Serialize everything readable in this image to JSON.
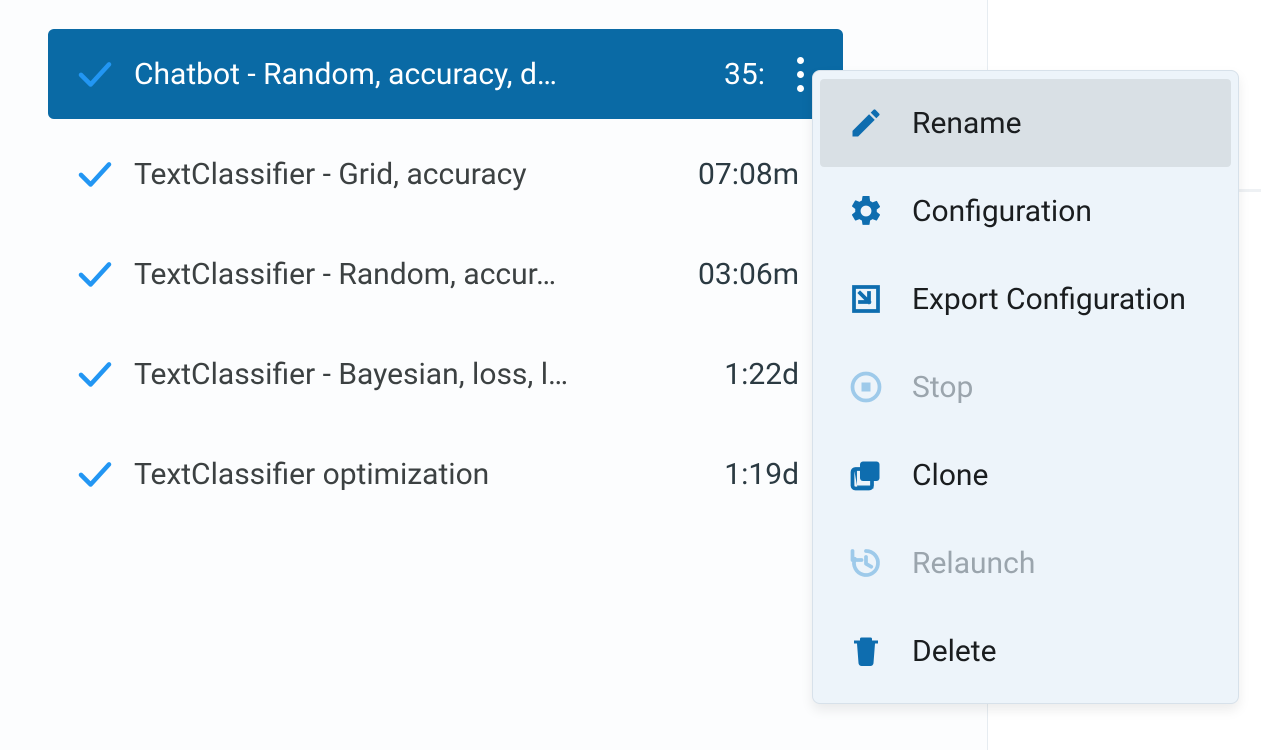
{
  "list": {
    "items": [
      {
        "label": "Chatbot - Random, accuracy, d…",
        "time": "35:"
      },
      {
        "label": "TextClassifier - Grid, accuracy",
        "time": "07:08m"
      },
      {
        "label": "TextClassifier - Random, accur…",
        "time": "03:06m"
      },
      {
        "label": "TextClassifier - Bayesian, loss, l…",
        "time": "1:22d"
      },
      {
        "label": "TextClassifier optimization",
        "time": "1:19d"
      }
    ]
  },
  "menu": {
    "rename": "Rename",
    "configuration": "Configuration",
    "export_configuration": "Export Configuration",
    "stop": "Stop",
    "clone": "Clone",
    "relaunch": "Relaunch",
    "delete": "Delete"
  },
  "colors": {
    "accent_blue": "#2296f3",
    "dark_blue": "#0e6daf",
    "selected_bg": "#0a6aa5",
    "disabled": "#9ba5ad"
  }
}
